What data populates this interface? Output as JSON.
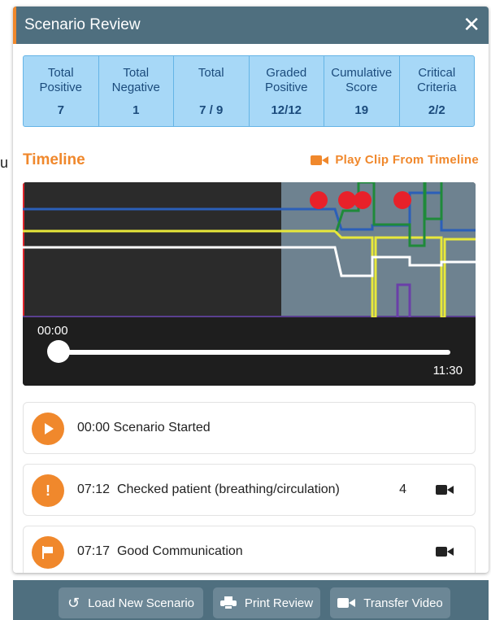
{
  "background_text": "u",
  "modal": {
    "title": "Scenario Review",
    "close_icon": "close-icon",
    "accent_color": "#f0882c",
    "header_color": "#4f6f7f"
  },
  "stats": [
    {
      "label_lines": [
        "Total",
        "Positive"
      ],
      "value": "7"
    },
    {
      "label_lines": [
        "Total",
        "Negative"
      ],
      "value": "1"
    },
    {
      "label_lines": [
        "Total",
        ""
      ],
      "value": "7 / 9"
    },
    {
      "label_lines": [
        "Graded",
        "Positive"
      ],
      "value": "12/12"
    },
    {
      "label_lines": [
        "Cumulative",
        "Score"
      ],
      "value": "19"
    },
    {
      "label_lines": [
        "Critical",
        "Criteria"
      ],
      "value": "2/2"
    }
  ],
  "timeline": {
    "title": "Timeline",
    "play_clip_label": "Play Clip From Timeline",
    "play_clip_icon": "video-camera-icon"
  },
  "player": {
    "current_time": "00:00",
    "duration": "11:30",
    "progress": 0.0
  },
  "events": [
    {
      "icon": "play-icon",
      "time": "00:00",
      "label": "Scenario Started",
      "count": "",
      "has_video": false
    },
    {
      "icon": "exclamation-icon",
      "time": "07:12",
      "label": "Checked patient (breathing/circulation)",
      "count": "4",
      "has_video": true
    },
    {
      "icon": "flag-icon",
      "time": "07:17",
      "label": "Good Communication",
      "count": "",
      "has_video": true
    }
  ],
  "footer": {
    "load_label": "Load New Scenario",
    "load_icon": "reload-icon",
    "print_label": "Print Review",
    "print_icon": "printer-icon",
    "transfer_label": "Transfer Video",
    "transfer_icon": "video-camera-icon"
  }
}
